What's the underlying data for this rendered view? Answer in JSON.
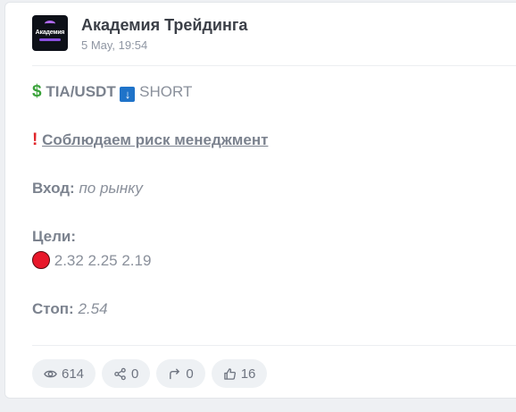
{
  "channel": {
    "name": "Академия Трейдинга",
    "date": "5 May, 19:54",
    "avatar_text": "Академия"
  },
  "post": {
    "pair": "TIA/USDT",
    "direction": "SHORT",
    "risk_text": "Соблюдаем риск менеджмент",
    "entry_label": "Вход:",
    "entry_value": "по рынку",
    "targets_label": "Цели:",
    "targets_value": "2.32 2.25 2.19",
    "stop_label": "Стоп:",
    "stop_value": "2.54"
  },
  "stats": {
    "views": "614",
    "shares": "0",
    "forwards": "0",
    "likes": "16"
  }
}
